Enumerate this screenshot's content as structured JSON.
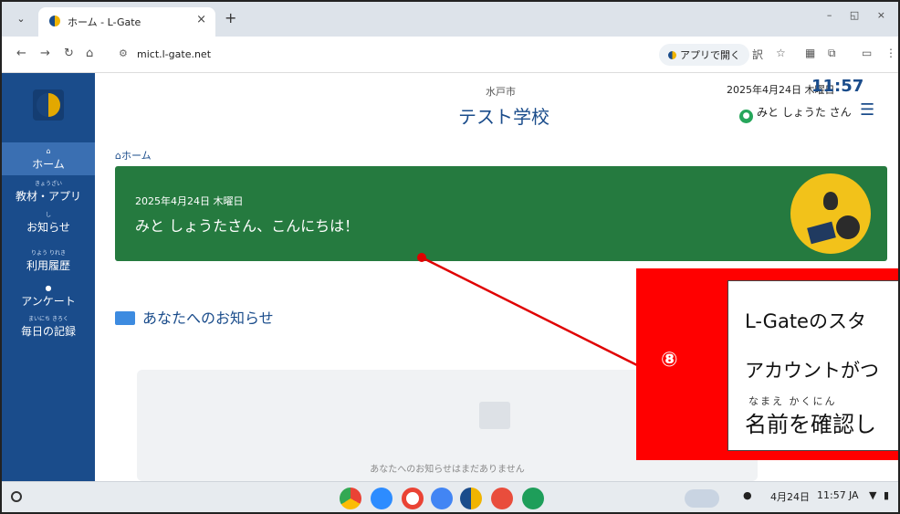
{
  "browser": {
    "tab_title": "ホーム - L-Gate",
    "url": "mict.l-gate.net",
    "open_app_label": "アプリで開く"
  },
  "sidebar": {
    "items": [
      {
        "label": "ホーム",
        "ruby": ""
      },
      {
        "label": "教材・アプリ",
        "ruby": "きょうざい"
      },
      {
        "label": "お知らせ",
        "ruby": "し"
      },
      {
        "label": "利用履歴",
        "ruby": "りよう りれき"
      },
      {
        "label": "アンケート",
        "ruby": ""
      },
      {
        "label": "毎日の記録",
        "ruby": "まいにち きろく"
      }
    ]
  },
  "header": {
    "city": "水戸市",
    "school": "テスト学校",
    "date": "2025年4月24日 木曜日",
    "time": "11:57",
    "user": "みと しょうた さん"
  },
  "breadcrumb": "ホーム",
  "banner": {
    "date": "2025年4月24日 木曜日",
    "greeting": "みと しょうたさん、こんにちは！"
  },
  "notices": {
    "heading": "あなたへのお知らせ",
    "empty_text": "あなたへのお知らせはまだありません"
  },
  "callout": {
    "number": "⑧",
    "line1": "L-Gateのスタ",
    "line2": "アカウントがつ",
    "line3": "名前を確認し",
    "line3_ruby": "なまえ かくにん",
    "color": "#ff0000"
  },
  "taskbar": {
    "date": "4月24日",
    "time": "11:57",
    "ime": "JA"
  }
}
